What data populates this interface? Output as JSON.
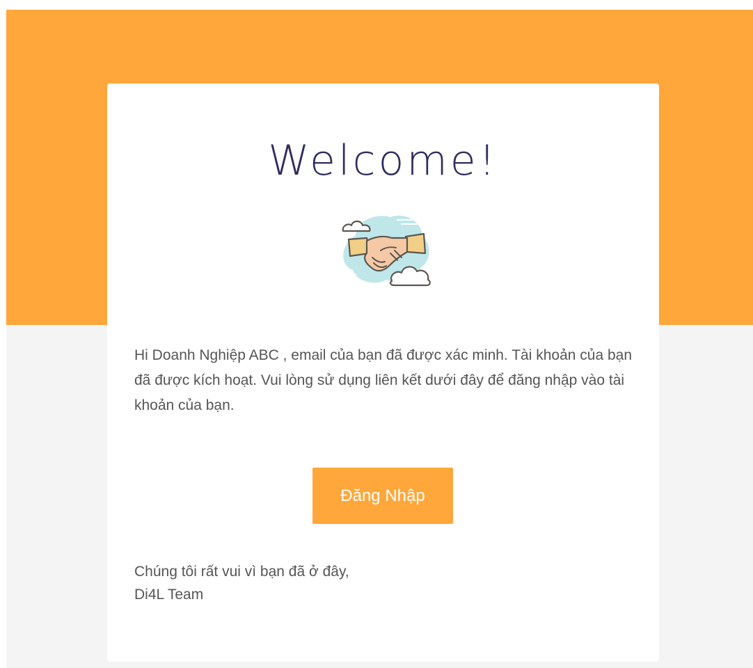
{
  "email": {
    "title": "Welcome!",
    "illustration_icon": "handshake-icon",
    "message": "Hi Doanh Nghiệp ABC , email của bạn đã được xác minh. Tài khoản của bạn đã được kích hoạt. Vui lòng sử dụng liên kết dưới đây để đăng nhập vào tài khoản của bạn.",
    "button_label": "Đăng Nhập",
    "signoff_line1": "Chúng tôi rất vui vì bạn đã ở đây,",
    "signoff_line2": "Di4L Team"
  },
  "colors": {
    "accent": "#ffa73b",
    "title": "#2f2d5e",
    "body_text": "#555555",
    "background": "#f4f4f4",
    "card": "#ffffff"
  }
}
